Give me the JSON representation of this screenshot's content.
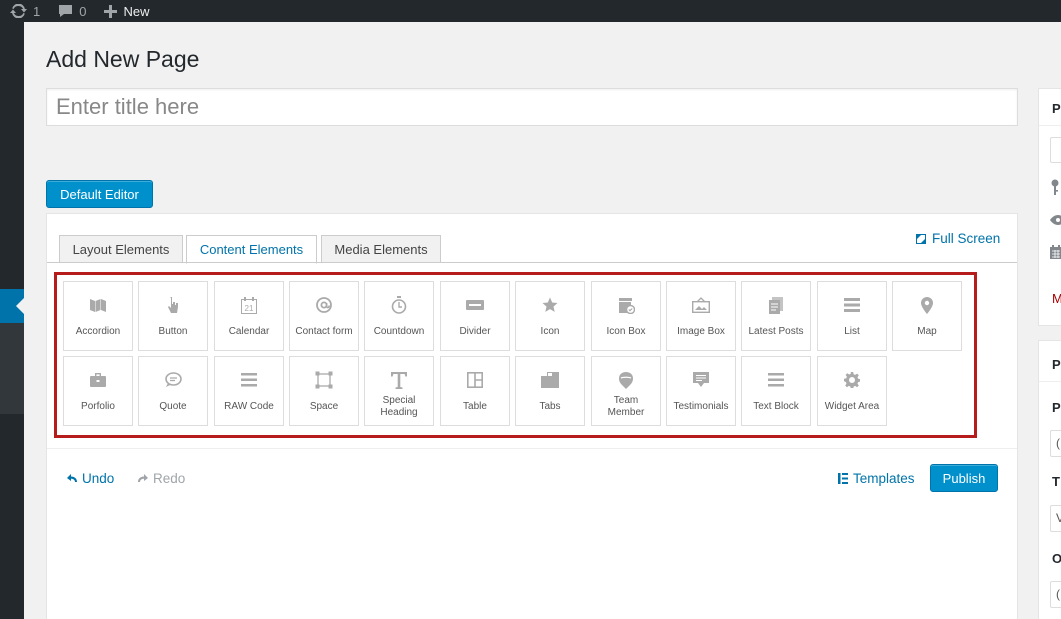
{
  "admin_bar": {
    "updates_count": "1",
    "comments_count": "0",
    "new_label": "New"
  },
  "page": {
    "heading": "Add New Page",
    "title_placeholder": "Enter title here"
  },
  "default_editor_button": "Default Editor",
  "builder": {
    "tabs": [
      {
        "label": "Layout Elements",
        "active": false
      },
      {
        "label": "Content Elements",
        "active": true
      },
      {
        "label": "Media Elements",
        "active": false
      }
    ],
    "fullscreen_label": "Full Screen",
    "elements": [
      {
        "label": "Accordion",
        "icon": "accordion-icon"
      },
      {
        "label": "Button",
        "icon": "pointer-icon"
      },
      {
        "label": "Calendar",
        "icon": "calendar-icon"
      },
      {
        "label": "Contact form",
        "icon": "at-sign-icon"
      },
      {
        "label": "Countdown",
        "icon": "stopwatch-icon"
      },
      {
        "label": "Divider",
        "icon": "divider-icon"
      },
      {
        "label": "Icon",
        "icon": "star-icon"
      },
      {
        "label": "Icon Box",
        "icon": "icon-box-icon"
      },
      {
        "label": "Image Box",
        "icon": "image-box-icon"
      },
      {
        "label": "Latest Posts",
        "icon": "posts-icon"
      },
      {
        "label": "List",
        "icon": "list-icon"
      },
      {
        "label": "Map",
        "icon": "map-pin-icon"
      },
      {
        "label": "Porfolio",
        "icon": "briefcase-icon"
      },
      {
        "label": "Quote",
        "icon": "speech-bubble-icon"
      },
      {
        "label": "RAW Code",
        "icon": "code-lines-icon"
      },
      {
        "label": "Space",
        "icon": "space-frame-icon"
      },
      {
        "label": "Special Heading",
        "icon": "text-t-icon"
      },
      {
        "label": "Table",
        "icon": "table-icon"
      },
      {
        "label": "Tabs",
        "icon": "tabs-icon"
      },
      {
        "label": "Team Member",
        "icon": "person-icon"
      },
      {
        "label": "Testimonials",
        "icon": "testimonial-icon"
      },
      {
        "label": "Text Block",
        "icon": "text-block-icon"
      },
      {
        "label": "Widget Area",
        "icon": "gear-icon"
      }
    ],
    "undo_label": "Undo",
    "redo_label": "Redo",
    "templates_label": "Templates",
    "publish_label": "Publish"
  },
  "sidebar": {
    "box1_letter": "P",
    "box1_red_letter": "M",
    "box2_letter": "P",
    "box2_field_letters": [
      "P",
      "T",
      "O"
    ],
    "box2_select_values": [
      "(",
      "V",
      "("
    ]
  },
  "colors": {
    "admin_bar": "#23282d",
    "accent": "#0073aa",
    "button": "#0091cd",
    "highlight_border": "#b71c1c"
  }
}
